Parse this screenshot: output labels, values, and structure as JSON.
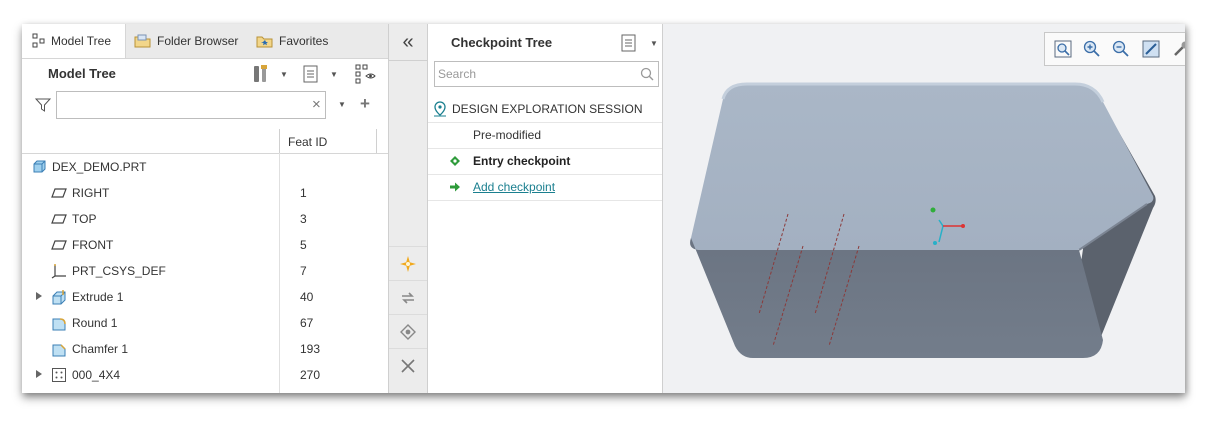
{
  "tabs": [
    {
      "label": "Model Tree",
      "icon": "model-tree-icon",
      "active": true
    },
    {
      "label": "Folder Browser",
      "icon": "folder-browser-icon",
      "active": false
    },
    {
      "label": "Favorites",
      "icon": "favorites-icon",
      "active": false
    }
  ],
  "model_tree": {
    "title": "Model Tree",
    "filter_value": "",
    "column_feat_id": "Feat ID",
    "rows": [
      {
        "name": "DEX_DEMO.PRT",
        "id": "",
        "icon": "part-icon",
        "expandable": false,
        "indent": 0
      },
      {
        "name": "RIGHT",
        "id": "1",
        "icon": "datum-plane-icon",
        "expandable": false,
        "indent": 1
      },
      {
        "name": "TOP",
        "id": "3",
        "icon": "datum-plane-icon",
        "expandable": false,
        "indent": 1
      },
      {
        "name": "FRONT",
        "id": "5",
        "icon": "datum-plane-icon",
        "expandable": false,
        "indent": 1
      },
      {
        "name": "PRT_CSYS_DEF",
        "id": "7",
        "icon": "csys-icon",
        "expandable": false,
        "indent": 1
      },
      {
        "name": "Extrude 1",
        "id": "40",
        "icon": "extrude-icon",
        "expandable": true,
        "indent": 1
      },
      {
        "name": "Round 1",
        "id": "67",
        "icon": "round-icon",
        "expandable": false,
        "indent": 1
      },
      {
        "name": "Chamfer 1",
        "id": "193",
        "icon": "chamfer-icon",
        "expandable": false,
        "indent": 1
      },
      {
        "name": "000_4X4",
        "id": "270",
        "icon": "pattern-icon",
        "expandable": true,
        "indent": 1
      }
    ]
  },
  "strip": {
    "collapse_label": "«"
  },
  "checkpoint": {
    "title": "Checkpoint Tree",
    "search_placeholder": "Search",
    "session_label": "DESIGN EXPLORATION SESSION",
    "pre_modified": "Pre-modified",
    "entry_checkpoint": "Entry checkpoint",
    "add_checkpoint": "Add checkpoint"
  },
  "colors": {
    "accent": "#1a7f8f",
    "model_top": "#a9b6c6",
    "model_front": "#6f7a88",
    "model_side": "#5a616c"
  }
}
